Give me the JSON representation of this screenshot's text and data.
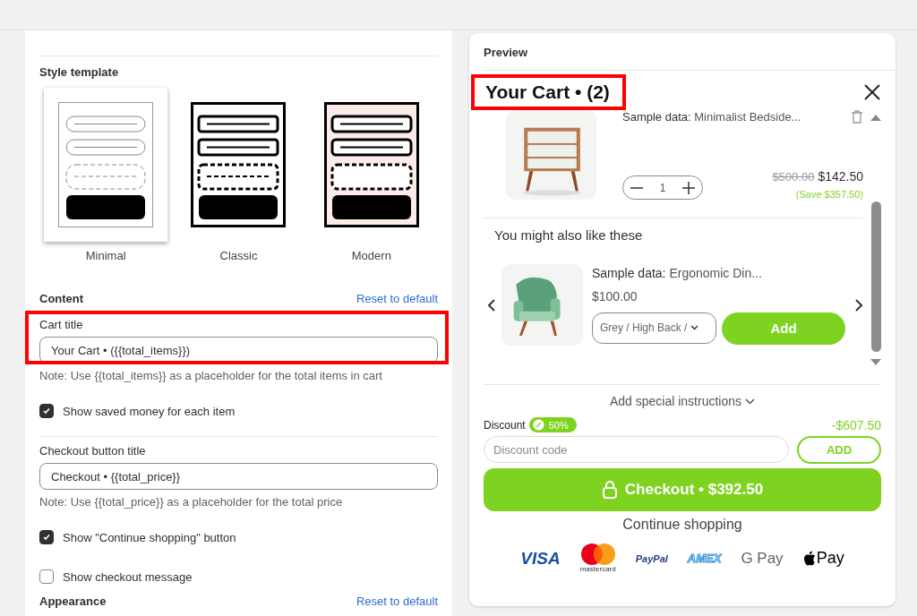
{
  "style_template": {
    "heading": "Style template",
    "options": [
      {
        "label": "Minimal",
        "kind": "minimal",
        "selected": true
      },
      {
        "label": "Classic",
        "kind": "classic",
        "selected": false
      },
      {
        "label": "Modern",
        "kind": "modern",
        "selected": false
      }
    ]
  },
  "content": {
    "heading": "Content",
    "reset_link": "Reset to default",
    "items": [
      {
        "kind": "field",
        "label": "Cart title",
        "value": "Your Cart • ({{total_items}})",
        "note": "Note: Use {{total_items}} as a placeholder for the total items in cart",
        "highlighted": true
      },
      {
        "kind": "checkbox",
        "label": "Show saved money for each item",
        "checked": true
      },
      {
        "kind": "field",
        "label": "Checkout button title",
        "value": "Checkout • {{total_price}}",
        "note": "Note: Use {{total_price}} as a placeholder for the total price",
        "highlighted": false
      },
      {
        "kind": "checkbox",
        "label": "Show \"Continue shopping\" button",
        "checked": true
      },
      {
        "kind": "checkbox",
        "label": "Show checkout message",
        "checked": false
      }
    ]
  },
  "appearance": {
    "heading": "Appearance",
    "reset_link": "Reset to default"
  },
  "preview": {
    "label": "Preview",
    "cart_title": "Your Cart • (2)",
    "title_highlighted": true,
    "cart_item": {
      "name_prefix": "Sample data:",
      "name": "Minimalist Bedside...",
      "quantity": "1",
      "old_price": "$500.00",
      "price": "$142.50",
      "saving": "(Save $357.50)"
    },
    "upsell": {
      "heading": "You might also like these",
      "name_prefix": "Sample data:",
      "name": "Ergonomic Din...",
      "price": "$100.00",
      "variant": "Grey / High Back /",
      "button": "Add"
    },
    "instructions": {
      "label": "Add special instructions",
      "expanded": false
    },
    "discount": {
      "label": "Discount",
      "badge": "50%",
      "amount": "-$607.50",
      "placeholder": "Discount code",
      "button": "ADD"
    },
    "checkout_button": "Checkout • $392.50",
    "continue_link": "Continue shopping",
    "payment_methods": [
      {
        "kind": "visa",
        "label": "VISA"
      },
      {
        "kind": "mastercard",
        "label": "mastercard"
      },
      {
        "kind": "paypal",
        "label": "PayPal"
      },
      {
        "kind": "amex",
        "label": "AMEX"
      },
      {
        "kind": "gpay",
        "label": "G Pay"
      },
      {
        "kind": "applepay",
        "label": "Pay"
      }
    ]
  }
}
